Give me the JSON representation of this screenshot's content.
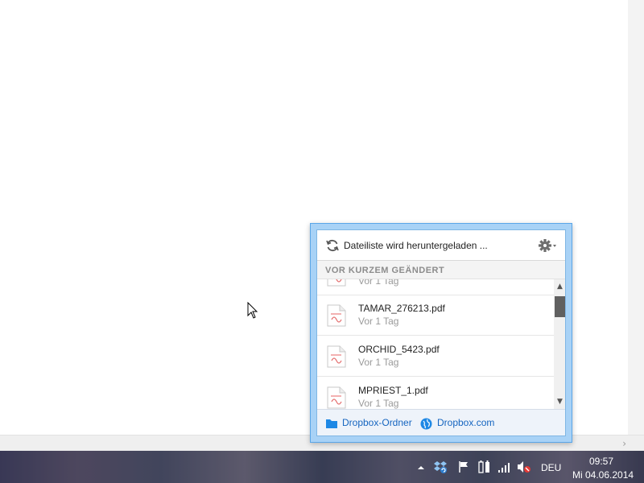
{
  "popup": {
    "status_text": "Dateiliste wird heruntergeladen ...",
    "section_label": "VOR KURZEM GEÄNDERT",
    "files": [
      {
        "name": "",
        "date": "Vor 1 Tag"
      },
      {
        "name": "TAMAR_276213.pdf",
        "date": "Vor 1 Tag"
      },
      {
        "name": "ORCHID_5423.pdf",
        "date": "Vor 1 Tag"
      },
      {
        "name": "MPRIEST_1.pdf",
        "date": "Vor 1 Tag"
      }
    ],
    "footer": {
      "folder_link": "Dropbox-Ordner",
      "web_link": "Dropbox.com"
    }
  },
  "taskbar": {
    "language": "DEU",
    "time": "09:57",
    "date": "Mi 04.06.2014"
  },
  "colors": {
    "accent": "#1565c0",
    "popup_border": "#a8d2f6",
    "file_icon_red": "#e57373"
  }
}
